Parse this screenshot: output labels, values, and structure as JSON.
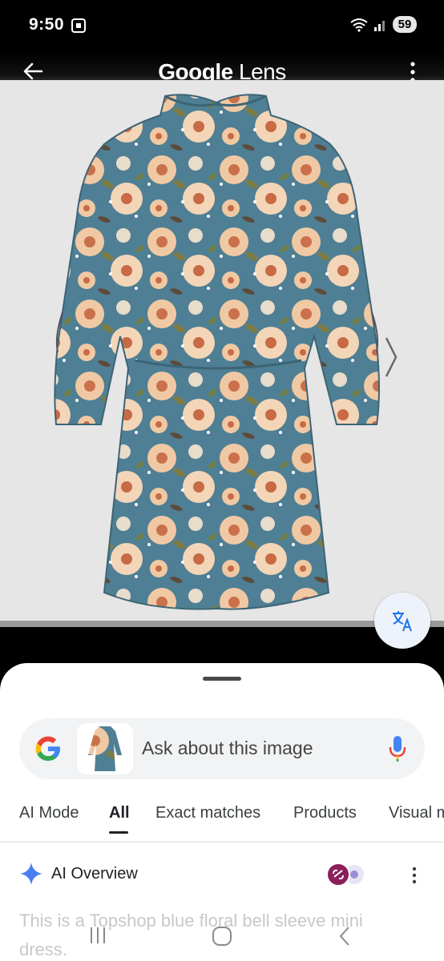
{
  "status_bar": {
    "time": "9:50",
    "battery": "59"
  },
  "top_bar": {
    "title_brand": "Google",
    "title_product": " Lens"
  },
  "search": {
    "placeholder": "Ask about this image"
  },
  "tabs": [
    {
      "label": "AI Mode"
    },
    {
      "label": "All"
    },
    {
      "label": "Exact matches"
    },
    {
      "label": "Products"
    },
    {
      "label": "Visual m"
    }
  ],
  "active_tab": "All",
  "ai_overview": {
    "title": "AI Overview",
    "text": "This is a Topshop blue floral bell sleeve mini dress."
  },
  "colors": {
    "accent_blue": "#1a73e8",
    "dress_teal": "#4f7f94",
    "flower_peach": "#f0c9a4"
  }
}
